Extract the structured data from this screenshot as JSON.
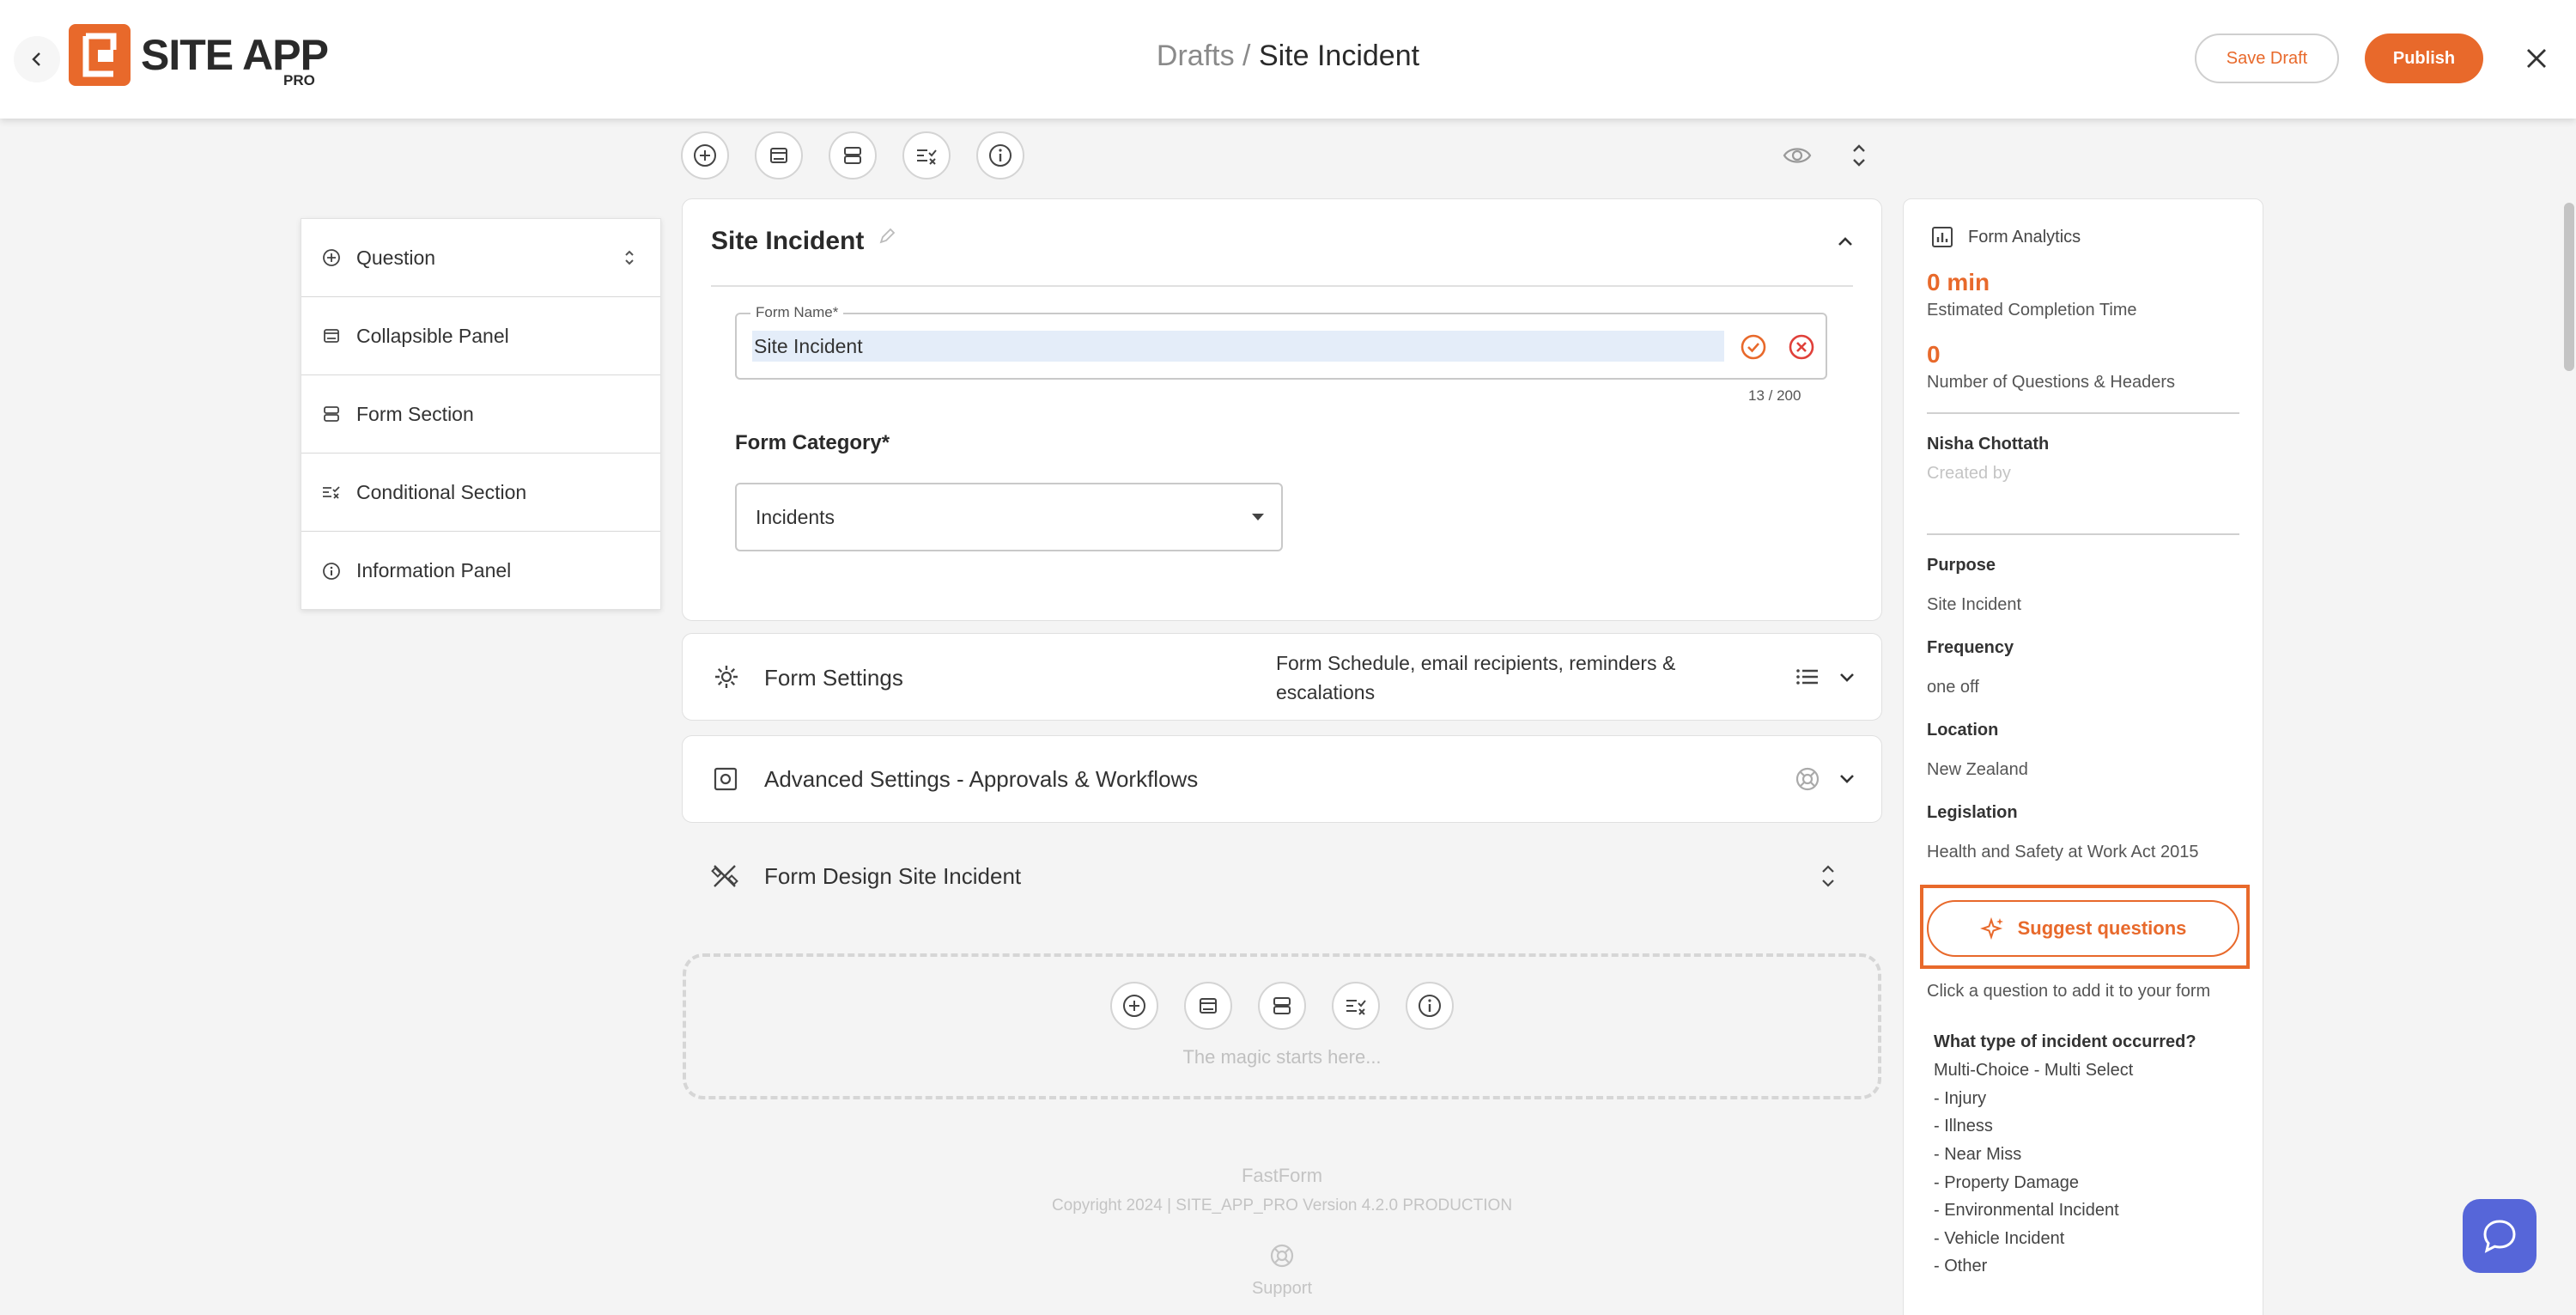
{
  "header": {
    "logo_text": "SITE APP",
    "logo_sub": "PRO",
    "breadcrumb_parent": "Drafts",
    "breadcrumb_sep": "/",
    "breadcrumb_current": "Site Incident",
    "save_draft_label": "Save Draft",
    "publish_label": "Publish"
  },
  "palette": {
    "items": [
      {
        "label": "Question",
        "icon": "plus-circle-icon"
      },
      {
        "label": "Collapsible Panel",
        "icon": "panel-icon"
      },
      {
        "label": "Form Section",
        "icon": "section-icon"
      },
      {
        "label": "Conditional Section",
        "icon": "conditional-icon"
      },
      {
        "label": "Information Panel",
        "icon": "info-icon"
      }
    ]
  },
  "form": {
    "title": "Site Incident",
    "name_label": "Form Name*",
    "name_value": "Site Incident",
    "counter": "13 / 200",
    "category_label": "Form Category*",
    "category_value": "Incidents"
  },
  "settings": {
    "title": "Form Settings",
    "description": "Form Schedule, email recipients, reminders & escalations"
  },
  "advanced": {
    "title": "Advanced Settings - Approvals & Workflows"
  },
  "design": {
    "title": "Form Design Site Incident",
    "empty_text": "The magic starts here..."
  },
  "footer": {
    "brand": "FastForm",
    "copyright": "Copyright 2024 | SITE_APP_PRO Version 4.2.0 PRODUCTION",
    "support": "Support"
  },
  "analytics": {
    "title": "Form Analytics",
    "time_value": "0 min",
    "time_label": "Estimated Completion Time",
    "count_value": "0",
    "count_label": "Number of Questions & Headers",
    "creator_name": "Nisha Chottath",
    "creator_label": "Created by",
    "purpose_label": "Purpose",
    "purpose_value": "Site Incident",
    "frequency_label": "Frequency",
    "frequency_value": "one off",
    "location_label": "Location",
    "location_value": "New Zealand",
    "legislation_label": "Legislation",
    "legislation_value": "Health and Safety at Work Act 2015",
    "suggest_label": "Suggest questions",
    "hint": "Click a question to add it to your form",
    "question": {
      "title": "What type of incident occurred?",
      "type": "Multi-Choice - Multi Select",
      "options": [
        "- Injury",
        "- Illness",
        "- Near Miss",
        "- Property Damage",
        "- Environmental Incident",
        "- Vehicle Incident",
        "- Other"
      ]
    }
  },
  "colors": {
    "accent": "#e8692b",
    "error": "#e0403a",
    "chat": "#5666d9"
  }
}
